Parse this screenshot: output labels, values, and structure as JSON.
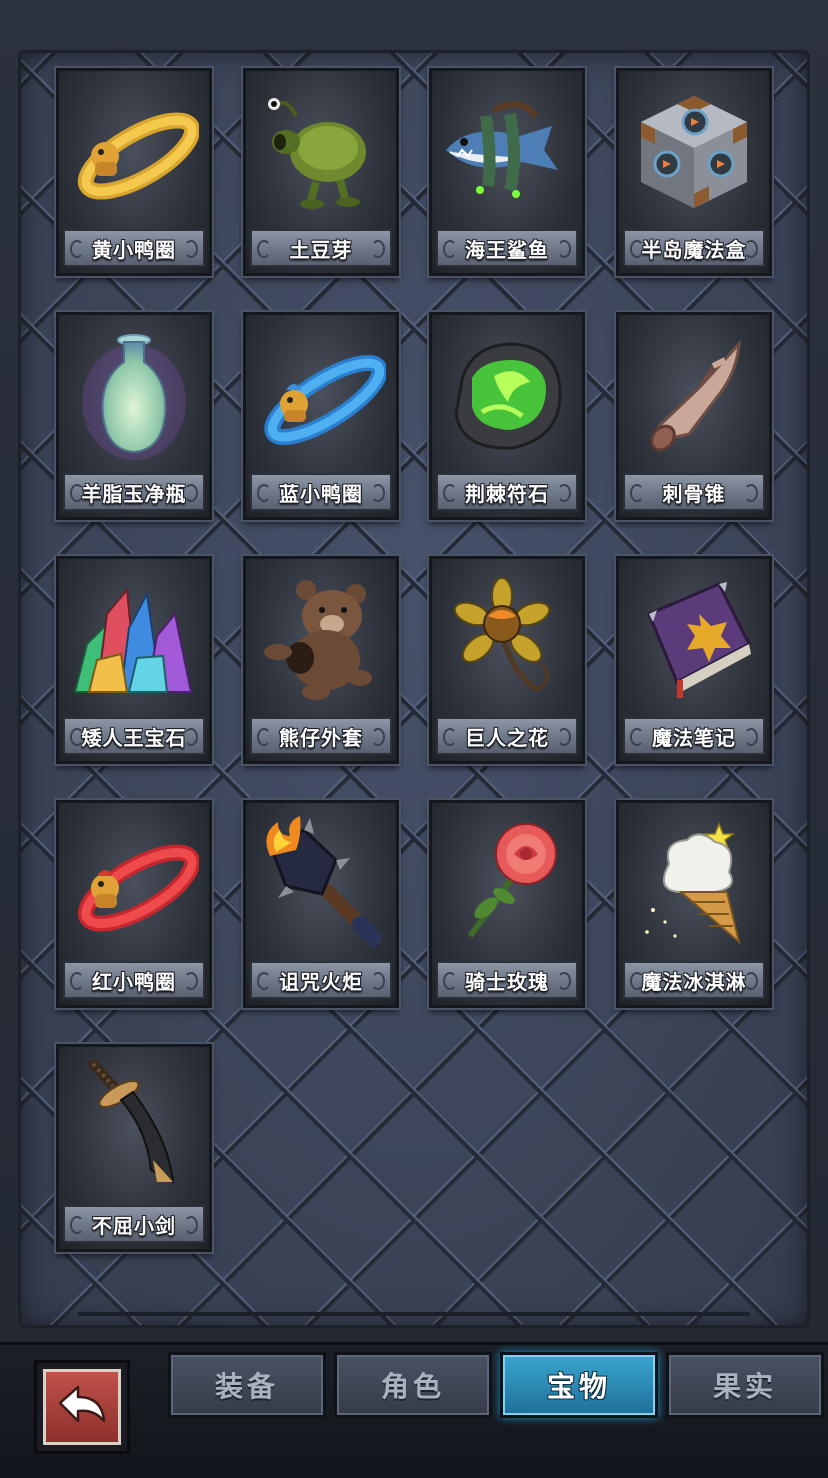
{
  "inventory": {
    "items": [
      {
        "name": "黄小鸭圈",
        "icon": "yellow-duck-ring-icon"
      },
      {
        "name": "土豆芽",
        "icon": "potato-sprout-icon"
      },
      {
        "name": "海王鲨鱼",
        "icon": "sea-king-shark-icon"
      },
      {
        "name": "半岛魔法盒",
        "icon": "peninsula-magic-box-icon"
      },
      {
        "name": "羊脂玉净瓶",
        "icon": "jade-vase-icon"
      },
      {
        "name": "蓝小鸭圈",
        "icon": "blue-duck-ring-icon"
      },
      {
        "name": "荆棘符石",
        "icon": "thorn-rune-stone-icon"
      },
      {
        "name": "刺骨锥",
        "icon": "bone-spike-icon"
      },
      {
        "name": "矮人王宝石",
        "icon": "dwarf-king-gems-icon"
      },
      {
        "name": "熊仔外套",
        "icon": "teddy-bear-coat-icon"
      },
      {
        "name": "巨人之花",
        "icon": "giant-flower-icon"
      },
      {
        "name": "魔法笔记",
        "icon": "magic-notebook-icon"
      },
      {
        "name": "红小鸭圈",
        "icon": "red-duck-ring-icon"
      },
      {
        "name": "诅咒火炬",
        "icon": "cursed-torch-icon"
      },
      {
        "name": "骑士玫瑰",
        "icon": "knight-rose-icon"
      },
      {
        "name": "魔法冰淇淋",
        "icon": "magic-ice-cream-icon"
      },
      {
        "name": "不屈小剑",
        "icon": "unyielding-dagger-icon"
      }
    ]
  },
  "nav": {
    "back_icon": "return-arrow-icon",
    "tabs": [
      {
        "label": "装备",
        "active": false
      },
      {
        "label": "角色",
        "active": false
      },
      {
        "label": "宝物",
        "active": true
      },
      {
        "label": "果实",
        "active": false
      }
    ]
  },
  "colors": {
    "active_tab": "#2a8fbd",
    "back_button": "#a8403a",
    "panel": "#3d4658"
  }
}
